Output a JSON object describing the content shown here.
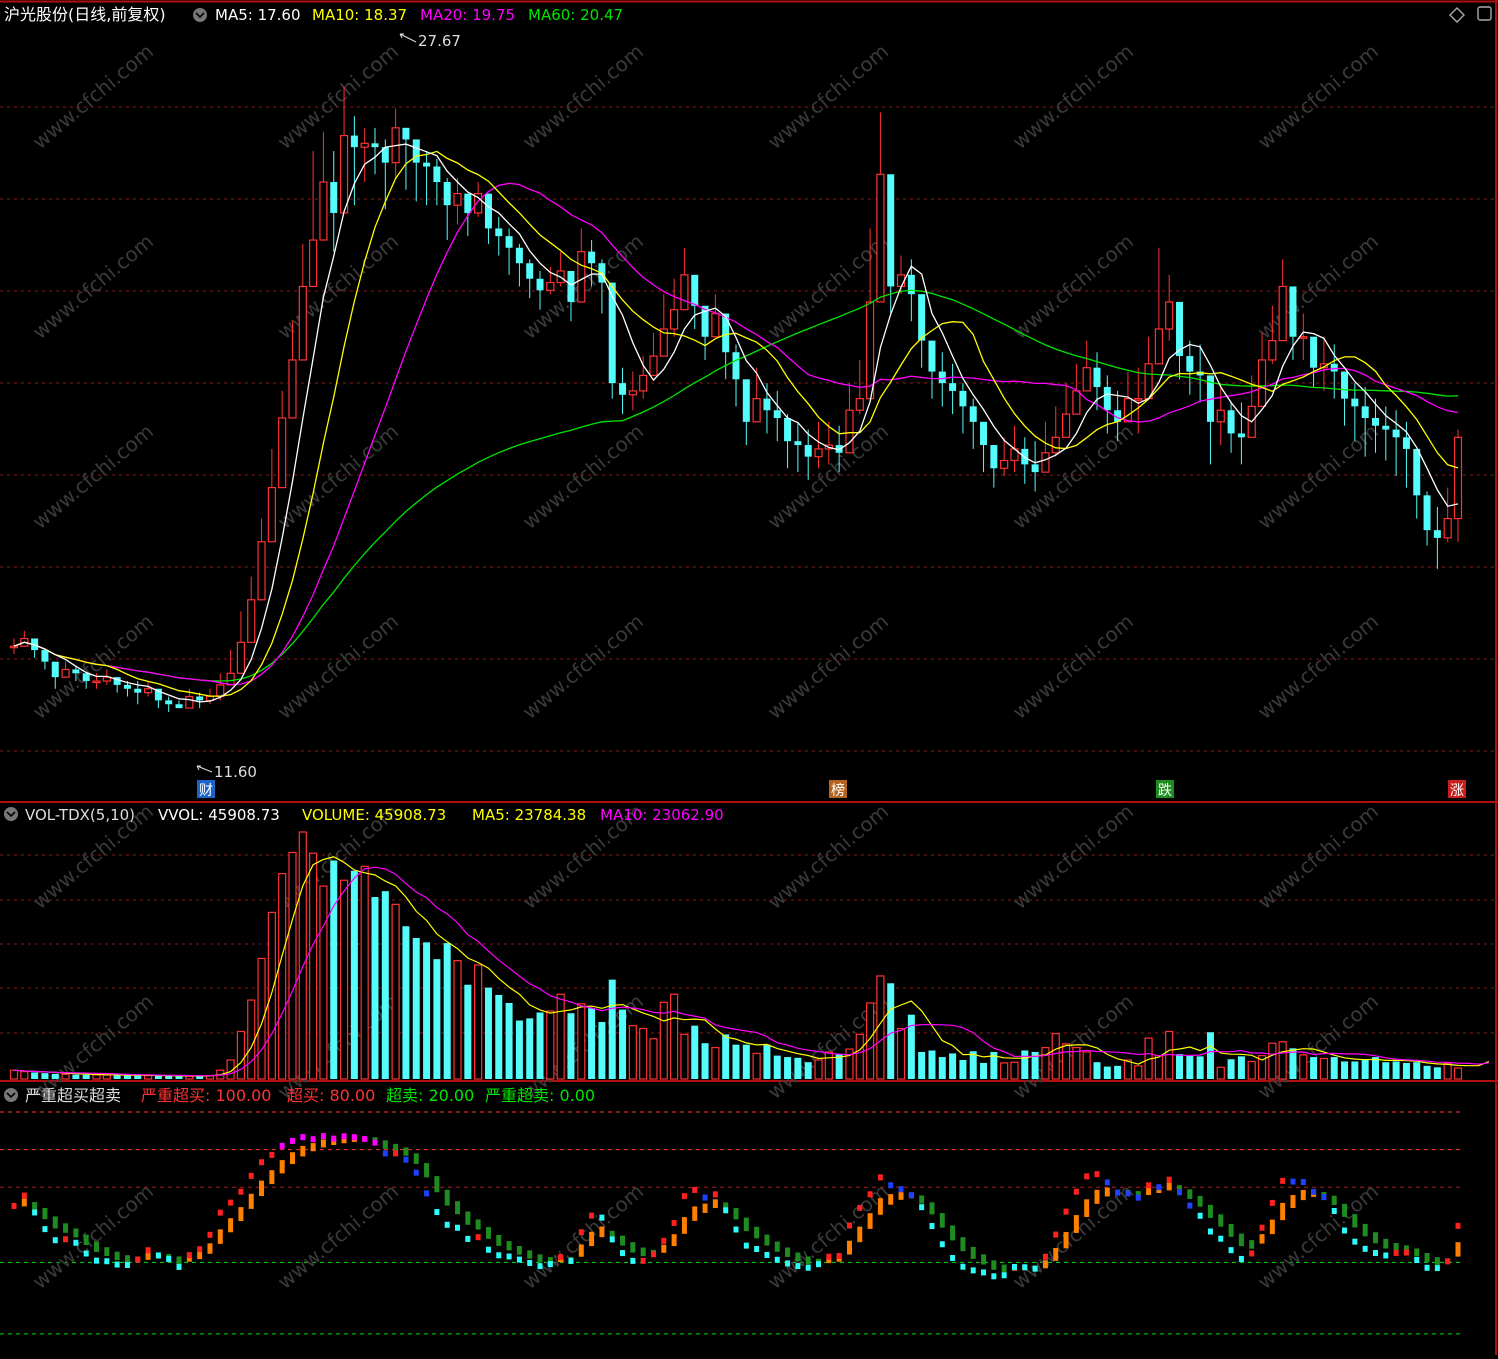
{
  "colors": {
    "background": "#000000",
    "up": "#FF3232",
    "down": "#54FCFC",
    "ma5": "#FFFFFF",
    "ma10": "#FFFF00",
    "ma20": "#FF00FF",
    "ma60": "#00E600",
    "grid": "#8B1A1A",
    "border": "#B01010"
  },
  "header": {
    "stock_title": "沪光股份(日线,前复权)",
    "ma5": "MA5: 17.60",
    "ma10": "MA10: 18.37",
    "ma20": "MA20: 19.75",
    "ma60": "MA60: 20.47",
    "max_label": "27.67",
    "min_label": "11.60",
    "events": [
      {
        "label": "财",
        "color": "#1E64C8"
      },
      {
        "label": "榜",
        "color": "#B4641E"
      },
      {
        "label": "跌",
        "color": "#1E8C1E"
      },
      {
        "label": "涨",
        "color": "#C81E1E"
      }
    ]
  },
  "volume_panel": {
    "name": "VOL-TDX(5,10)",
    "vvol": "VVOL: 45908.73",
    "volume": "VOLUME: 45908.73",
    "ma5": "MA5: 23784.38",
    "ma10": "MA10: 23062.90"
  },
  "indicator_panel": {
    "name": "严重超买超卖",
    "l1": "严重超买: 100.00",
    "l2": "超买: 80.00",
    "l3": "超卖: 20.00",
    "l4": "严重超卖: 0.00"
  },
  "chart_data": [
    {
      "type": "candlestick",
      "price_axis_range": [
        10,
        29
      ],
      "closes": [
        13.2,
        13.4,
        13.1,
        12.8,
        12.4,
        12.6,
        12.5,
        12.3,
        12.3,
        12.4,
        12.2,
        12.1,
        12.0,
        12.1,
        11.8,
        11.7,
        11.6,
        11.9,
        11.8,
        11.9,
        12.2,
        12.5,
        13.3,
        14.4,
        15.9,
        17.3,
        19.1,
        20.6,
        22.5,
        23.7,
        25.2,
        24.4,
        26.4,
        26.1,
        26.2,
        26.1,
        25.7,
        26.6,
        26.3,
        25.7,
        25.6,
        25.2,
        24.6,
        24.9,
        24.4,
        24.9,
        24.0,
        23.8,
        23.5,
        23.1,
        22.7,
        22.4,
        22.6,
        22.9,
        22.1,
        23.4,
        23.1,
        22.6,
        20.0,
        19.7,
        19.8,
        20.2,
        20.7,
        21.4,
        21.9,
        22.8,
        22.0,
        21.2,
        21.8,
        20.8,
        20.1,
        19.0,
        19.6,
        19.3,
        19.1,
        18.5,
        18.4,
        18.1,
        18.3,
        18.4,
        18.2,
        19.3,
        19.6,
        22.1,
        25.4,
        22.5,
        22.8,
        22.3,
        21.1,
        20.3,
        20.0,
        19.8,
        19.4,
        19.0,
        18.4,
        17.8,
        18.0,
        18.3,
        17.9,
        17.7,
        18.2,
        18.6,
        19.2,
        19.8,
        20.4,
        19.9,
        19.3,
        19.0,
        19.6,
        19.6,
        20.5,
        21.4,
        22.1,
        20.7,
        20.3,
        20.2,
        19.0,
        19.3,
        18.7,
        18.6,
        19.4,
        20.6,
        21.1,
        22.5,
        21.2,
        21.2,
        20.4,
        20.5,
        20.3,
        19.6,
        19.4,
        19.1,
        18.9,
        18.8,
        18.6,
        18.3,
        17.1,
        16.2,
        16.0,
        16.5,
        18.6
      ],
      "highs": [
        13.4,
        13.6,
        13.3,
        13.0,
        12.7,
        12.8,
        12.7,
        12.5,
        12.5,
        12.6,
        12.4,
        12.3,
        12.3,
        12.3,
        12.1,
        11.9,
        11.8,
        12.1,
        12.0,
        12.1,
        12.5,
        13.1,
        14.1,
        15.0,
        16.5,
        18.3,
        19.8,
        21.6,
        23.6,
        26.0,
        26.5,
        26.0,
        27.67,
        26.9,
        26.6,
        26.6,
        26.3,
        27.1,
        26.6,
        26.1,
        26.0,
        25.8,
        25.3,
        25.3,
        24.9,
        25.2,
        24.6,
        24.3,
        24.0,
        23.6,
        23.2,
        22.9,
        23.0,
        23.4,
        22.8,
        24.0,
        23.7,
        23.2,
        21.4,
        20.4,
        20.3,
        20.7,
        21.3,
        22.3,
        22.7,
        23.5,
        22.7,
        21.9,
        22.3,
        21.4,
        21.0,
        20.0,
        20.4,
        20.0,
        19.8,
        19.2,
        19.0,
        18.8,
        19.0,
        19.0,
        18.9,
        20.0,
        20.6,
        24.0,
        27.0,
        24.2,
        23.3,
        23.2,
        22.2,
        21.1,
        20.8,
        20.5,
        20.0,
        19.6,
        19.0,
        18.4,
        18.6,
        18.9,
        18.6,
        18.5,
        19.0,
        19.4,
        20.0,
        20.5,
        21.1,
        20.8,
        20.2,
        19.8,
        20.3,
        20.4,
        21.2,
        23.5,
        22.8,
        22.0,
        21.1,
        21.0,
        20.0,
        20.0,
        19.5,
        19.5,
        20.2,
        21.3,
        22.0,
        23.2,
        22.0,
        21.8,
        21.2,
        21.2,
        21.0,
        20.3,
        20.0,
        19.9,
        19.6,
        19.4,
        19.3,
        19.0,
        18.0,
        17.2,
        16.8,
        17.3,
        18.8
      ],
      "lows": [
        13.0,
        13.2,
        12.9,
        12.6,
        12.1,
        12.4,
        12.3,
        12.1,
        12.1,
        12.2,
        12.0,
        11.9,
        11.7,
        11.9,
        11.6,
        11.5,
        11.6,
        11.6,
        11.6,
        11.7,
        11.8,
        12.2,
        12.9,
        14.0,
        15.5,
        16.7,
        18.6,
        19.9,
        21.8,
        22.8,
        24.0,
        23.4,
        24.8,
        24.6,
        25.2,
        25.4,
        24.5,
        25.3,
        25.0,
        24.7,
        24.6,
        24.6,
        23.7,
        24.1,
        23.8,
        24.3,
        23.6,
        23.3,
        22.8,
        22.5,
        22.2,
        21.9,
        22.3,
        22.5,
        21.6,
        22.6,
        22.5,
        21.8,
        19.6,
        19.2,
        19.3,
        19.6,
        20.3,
        21.0,
        21.2,
        22.1,
        21.4,
        20.6,
        21.2,
        20.1,
        19.4,
        18.4,
        19.0,
        18.7,
        18.5,
        17.8,
        17.7,
        17.5,
        17.8,
        17.9,
        17.7,
        18.7,
        19.2,
        21.4,
        24.4,
        21.8,
        22.3,
        21.6,
        20.4,
        19.6,
        19.4,
        19.2,
        18.7,
        18.3,
        17.7,
        17.3,
        17.6,
        17.7,
        17.4,
        17.2,
        17.7,
        18.1,
        18.8,
        19.3,
        19.9,
        19.3,
        18.7,
        18.5,
        19.2,
        18.7,
        19.9,
        20.9,
        21.1,
        20.1,
        19.7,
        19.5,
        17.9,
        18.4,
        18.2,
        17.9,
        18.9,
        19.8,
        20.5,
        21.8,
        20.6,
        20.6,
        19.9,
        19.8,
        19.6,
        18.9,
        18.5,
        18.1,
        18.2,
        18.0,
        17.6,
        17.3,
        16.5,
        15.8,
        15.2,
        15.9,
        15.9
      ],
      "volumes": [
        1200,
        1000,
        900,
        800,
        700,
        650,
        600,
        580,
        560,
        540,
        520,
        500,
        480,
        460,
        440,
        420,
        400,
        380,
        420,
        480,
        1200,
        2600,
        6500,
        10800,
        16500,
        22800,
        28100,
        31000,
        33800,
        30900,
        26400,
        29900,
        27200,
        28500,
        29100,
        24900,
        25700,
        23900,
        20900,
        19300,
        18700,
        16400,
        18600,
        16200,
        12900,
        15600,
        12500,
        11500,
        10400,
        8000,
        8300,
        9100,
        9300,
        11600,
        9000,
        10300,
        9700,
        7800,
        13600,
        9500,
        7300,
        6900,
        5500,
        10500,
        11600,
        6100,
        7300,
        4900,
        4300,
        6100,
        4700,
        4700,
        3500,
        4700,
        3200,
        3000,
        2900,
        2300,
        2600,
        3700,
        3400,
        4100,
        6100,
        10400,
        14100,
        13100,
        6900,
        8800,
        3700,
        3900,
        3000,
        3500,
        2600,
        3800,
        2200,
        3700,
        2200,
        2300,
        3900,
        3700,
        4300,
        6200,
        4800,
        4300,
        3700,
        2300,
        1700,
        1800,
        2600,
        1800,
        5600,
        3200,
        6500,
        3400,
        3200,
        3100,
        6400,
        1600,
        2700,
        3100,
        2400,
        3200,
        4900,
        5100,
        4200,
        3300,
        3000,
        2800,
        3000,
        2400,
        2400,
        2600,
        3000,
        2300,
        2400,
        2200,
        2300,
        1800,
        1600,
        2100,
        1500,
        2100,
        1900,
        4300
      ],
      "vol_ma5_last": 23784.38,
      "vol_ma10_last": 23062.9,
      "last": {
        "ma5": 17.6,
        "ma10": 18.37,
        "ma20": 19.75,
        "ma60": 20.47,
        "volume": 45908.73
      },
      "marks": {
        "high": 27.67,
        "low": 11.6
      }
    },
    {
      "type": "oscillator",
      "name": "严重超买超卖",
      "levels": [
        100,
        80,
        20,
        0
      ],
      "ylim": [
        -10,
        110
      ]
    }
  ]
}
